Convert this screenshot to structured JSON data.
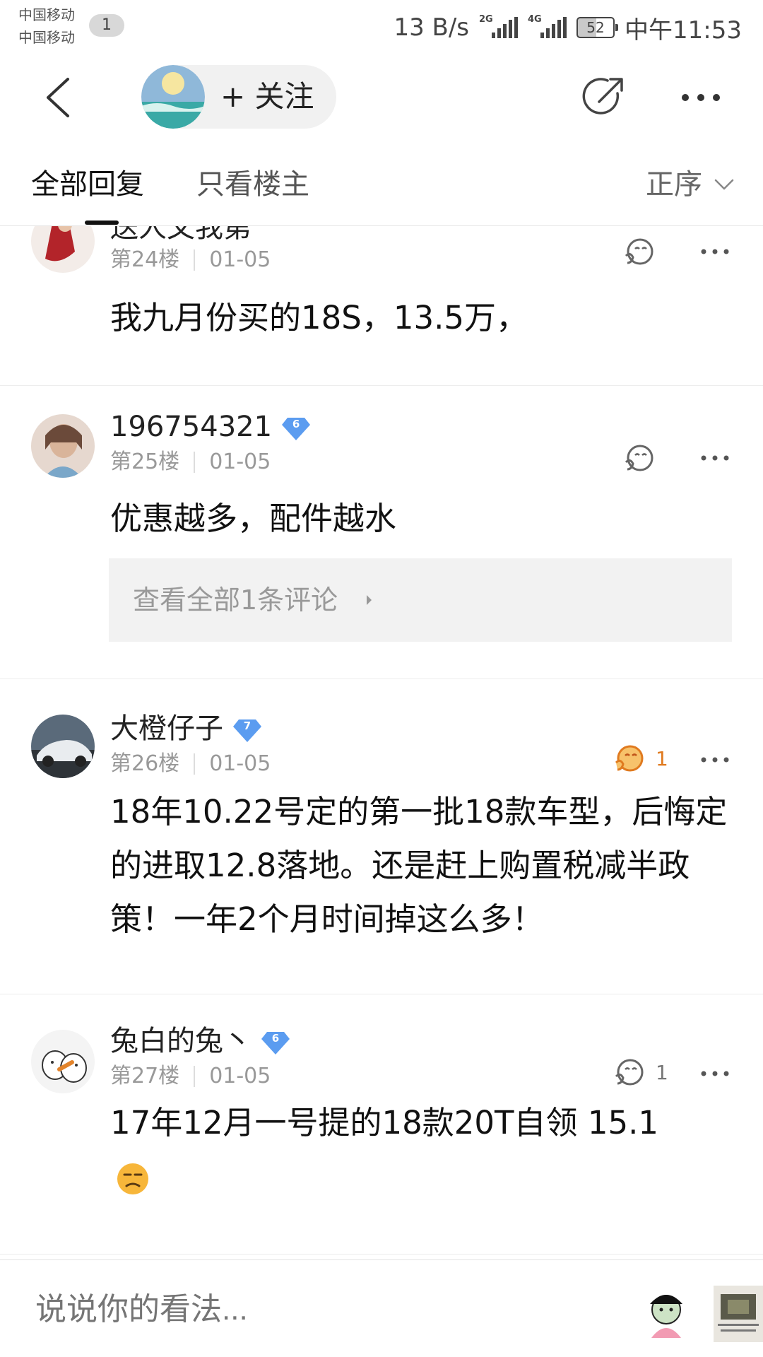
{
  "status_bar": {
    "carrier_1": "中国移动",
    "carrier_2": "中国移动",
    "notification_count": "1",
    "net_speed": "13 B/s",
    "signal_1_tag": "2G",
    "signal_2_tag": "4G",
    "battery": "52",
    "time": "中午11:53"
  },
  "header": {
    "follow_label": "+ 关注"
  },
  "tabs": {
    "all_replies": "全部回复",
    "owner_only": "只看楼主",
    "sort": "正序"
  },
  "posts": [
    {
      "username": "送人文我第",
      "floor": "第24楼",
      "date": "01-05",
      "likes": "",
      "content": "我九月份买的18S，13.5万，"
    },
    {
      "username": "196754321",
      "level": "6",
      "floor": "第25楼",
      "date": "01-05",
      "likes": "",
      "content": "优惠越多，配件越水",
      "subcomment_link": "查看全部1条评论"
    },
    {
      "username": "大橙仔子",
      "level": "7",
      "floor": "第26楼",
      "date": "01-05",
      "likes": "1",
      "content": "18年10.22号定的第一批18款车型，后悔定的进取12.8落地。还是赶上购置税减半政策！一年2个月时间掉这么多！"
    },
    {
      "username": "兔白的兔丶",
      "level": "6",
      "floor": "第27楼",
      "date": "01-05",
      "likes": "1",
      "content": "17年12月一号提的18款20T自领 15.1"
    }
  ],
  "bottom_bar": {
    "comment_placeholder": "说说你的看法..."
  },
  "colors": {
    "accent_liked": "#e07a1f",
    "level_badge": "#5b9cf0",
    "text_primary": "#111111",
    "text_meta": "#999999"
  }
}
